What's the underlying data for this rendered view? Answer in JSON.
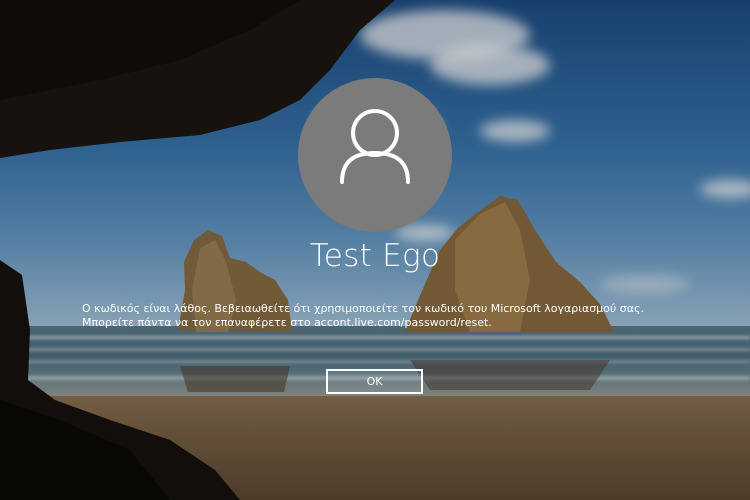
{
  "user": {
    "display_name": "Test Ego",
    "avatar_icon": "user-silhouette-icon"
  },
  "dialog": {
    "message": "Ο κωδικός είναι λάθος. Βεβειαωθείτε ότι χρησιμοποιείτε τον κωδικό του Microsoft λογαριασμού σας. Μπορείτε πάντα να τον επαναφέρετε στο accont.live.com/password/reset.",
    "ok_label": "OK"
  },
  "colors": {
    "avatar_background": "#7b7b7b",
    "text": "#ffffff"
  }
}
